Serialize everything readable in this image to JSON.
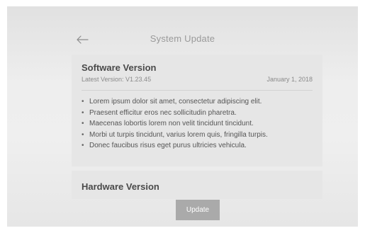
{
  "header": {
    "title": "System Update",
    "back_icon": "arrow-left-icon"
  },
  "software": {
    "title": "Software Version",
    "latest_version": "Latest Version: V1.23.45",
    "date": "January 1, 2018",
    "notes": [
      "Lorem ipsum dolor sit amet, consectetur adipiscing elit.",
      "Praesent efficitur eros nec sollicitudin pharetra.",
      "Maecenas lobortis lorem non velit tincidunt tincidunt.",
      "Morbi ut turpis tincidunt, varius lorem quis, fringilla turpis.",
      "Donec faucibus risus eget purus ultricies vehicula."
    ]
  },
  "hardware": {
    "title": "Hardware Version"
  },
  "actions": {
    "update_label": "Update"
  },
  "colors": {
    "button": "#aaaaaa",
    "card": "#e6e6e6",
    "title_text": "#9a9a9a"
  }
}
